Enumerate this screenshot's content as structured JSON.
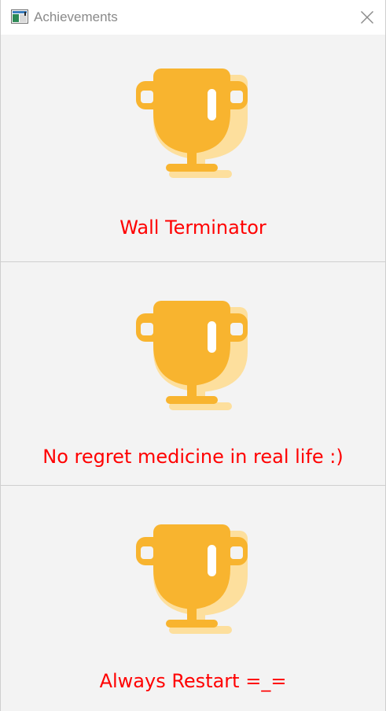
{
  "window": {
    "title": "Achievements",
    "app_icon": "app-window-icon",
    "close_icon": "close-icon"
  },
  "achievements": [
    {
      "title": "Wall Terminator",
      "icon": "trophy-icon"
    },
    {
      "title": "No regret medicine in real life :)",
      "icon": "trophy-icon"
    },
    {
      "title": "Always Restart =_=",
      "icon": "trophy-icon"
    }
  ],
  "colors": {
    "title_text": "#ff0000",
    "trophy": "#f8b42f",
    "trophy_shadow": "#fddf9d",
    "window_bg": "#f3f3f3"
  }
}
